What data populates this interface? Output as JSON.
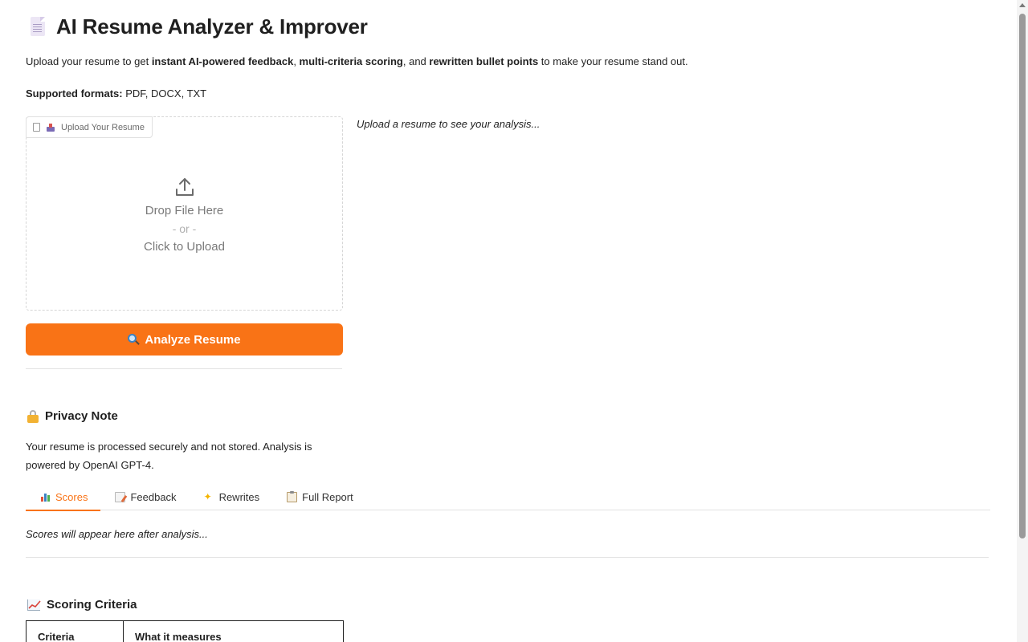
{
  "header": {
    "title": "AI Resume Analyzer & Improver",
    "icon": "page-facing-up-icon"
  },
  "intro": {
    "prefix": "Upload your resume to get ",
    "bold1": "instant AI-powered feedback",
    "sep1": ", ",
    "bold2": "multi-criteria scoring",
    "sep2": ", and ",
    "bold3": "rewritten bullet points",
    "suffix": " to make your resume stand out."
  },
  "formats": {
    "label": "Supported formats:",
    "value": " PDF, DOCX, TXT"
  },
  "upload": {
    "tab_label": "Upload Your Resume",
    "drop_text": "Drop File Here",
    "or_text": "- or -",
    "click_text": "Click to Upload"
  },
  "analyze_button": {
    "label": "Analyze Resume",
    "color": "#f97316"
  },
  "output": {
    "placeholder": "Upload a resume to see your analysis..."
  },
  "privacy": {
    "heading": "Privacy Note",
    "text": "Your resume is processed securely and not stored. Analysis is powered by OpenAI GPT-4."
  },
  "tabs": [
    {
      "label": "Scores",
      "icon": "bar-chart-icon",
      "active": true
    },
    {
      "label": "Feedback",
      "icon": "memo-icon",
      "active": false
    },
    {
      "label": "Rewrites",
      "icon": "sparkles-icon",
      "active": false
    },
    {
      "label": "Full Report",
      "icon": "clipboard-icon",
      "active": false
    }
  ],
  "scores_placeholder": "Scores will appear here after analysis...",
  "criteria": {
    "heading": "Scoring Criteria",
    "columns": [
      "Criteria",
      "What it measures"
    ]
  },
  "accent_color": "#f97316"
}
